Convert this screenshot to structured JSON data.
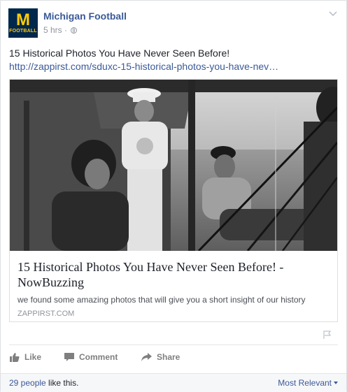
{
  "post": {
    "page_name": "Michigan Football",
    "logo": {
      "letter": "M",
      "text": "FOOTBALL",
      "colors": {
        "bg": "#00274c",
        "fg": "#ffcb05"
      }
    },
    "time": "5 hrs",
    "separator": "·",
    "privacy_icon": "globe-icon",
    "message": "15 Historical Photos You Have Never Seen Before!",
    "link": "http://zappirst.com/sduxc-15-historical-photos-you-have-nev…"
  },
  "attachment": {
    "title": "15 Historical Photos You Have Never Seen Before! - NowBuzzing",
    "description": "we found some amazing photos that will give you a short insight of our history",
    "domain": "ZAPPIRST.COM"
  },
  "actions": {
    "like": "Like",
    "comment": "Comment",
    "share": "Share"
  },
  "footer": {
    "likes_count": "29 people",
    "likes_suffix": " like this.",
    "sort_label": "Most Relevant"
  },
  "colors": {
    "link": "#3b5998",
    "text": "#1d2129",
    "muted": "#90949c"
  }
}
